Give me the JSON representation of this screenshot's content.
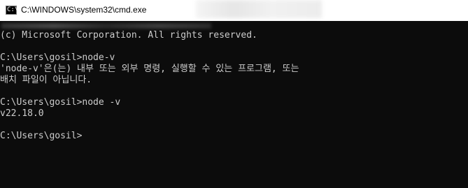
{
  "window": {
    "title": "C:\\WINDOWS\\system32\\cmd.exe",
    "icon": "cmd-icon",
    "icon_glyph": "C:\\"
  },
  "console": {
    "lines": [
      "(c) Microsoft Corporation. All rights reserved.",
      "",
      "C:\\Users\\gosil>node-v",
      "'node-v'은(는) 내부 또는 외부 명령, 실행할 수 있는 프로그램, 또는",
      "배치 파일이 아닙니다.",
      "",
      "C:\\Users\\gosil>node -v",
      "v22.18.0",
      "",
      "C:\\Users\\gosil>"
    ]
  },
  "colors": {
    "console_bg": "#0c0c0c",
    "console_fg": "#cccccc",
    "titlebar_bg": "#ffffff"
  }
}
